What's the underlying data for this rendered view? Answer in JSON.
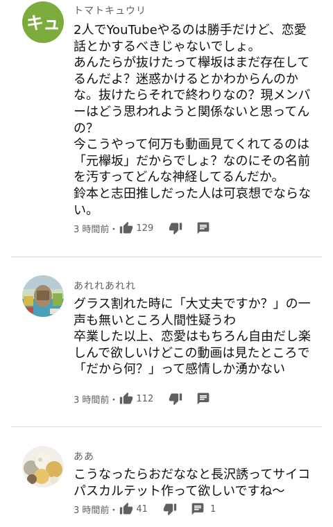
{
  "comments": [
    {
      "author": "トマトキュウリ",
      "avatar_initials": "キュ",
      "avatar_color": "#7cab3e",
      "text": "2人でYouTubeやるのは勝手だけど、恋愛話とかするべきじゃないでしょ。\nあんたらが抜けたって欅坂はまだ存在してるんだよ？迷惑かけるとかわからんのかな。抜けたらそれで終わりなの？現メンバーはどう思われようと関係ないと思ってんの？\n今こうやって何万も動画見てくれてるのは「元欅坂」だからでしょ？なのにその名前を汚すってどんな神経してるんだか。\n鈴本と志田推しだった人は可哀想でならない。",
      "timestamp": "3 時間前・",
      "likes": "129",
      "replies": ""
    },
    {
      "author": "あれれあれれ",
      "avatar_initials": "",
      "avatar_color": "",
      "text": "グラス割れた時に「大丈夫ですか？」の一声も無いところ人間性疑うわ\n卒業した以上、恋愛はもちろん自由だし楽しんで欲しいけどこの動画は見たところで「だから何？」って感情しか湧かない",
      "timestamp": "3 時間前・",
      "likes": "112",
      "replies": ""
    },
    {
      "author": "ああ",
      "avatar_initials": "",
      "avatar_color": "",
      "text": "こうなったらおだななと長沢誘ってサイコパスカルテット作って欲しいですね〜",
      "timestamp": "3 時間前・",
      "likes": "41",
      "replies": "1"
    }
  ],
  "icons": {
    "like": "thumbs-up-icon",
    "dislike": "thumbs-down-icon",
    "reply": "comment-reply-icon"
  },
  "colors": {
    "text": "#0f0f0f",
    "secondary": "#606060",
    "divider": "#d9d9d9"
  }
}
